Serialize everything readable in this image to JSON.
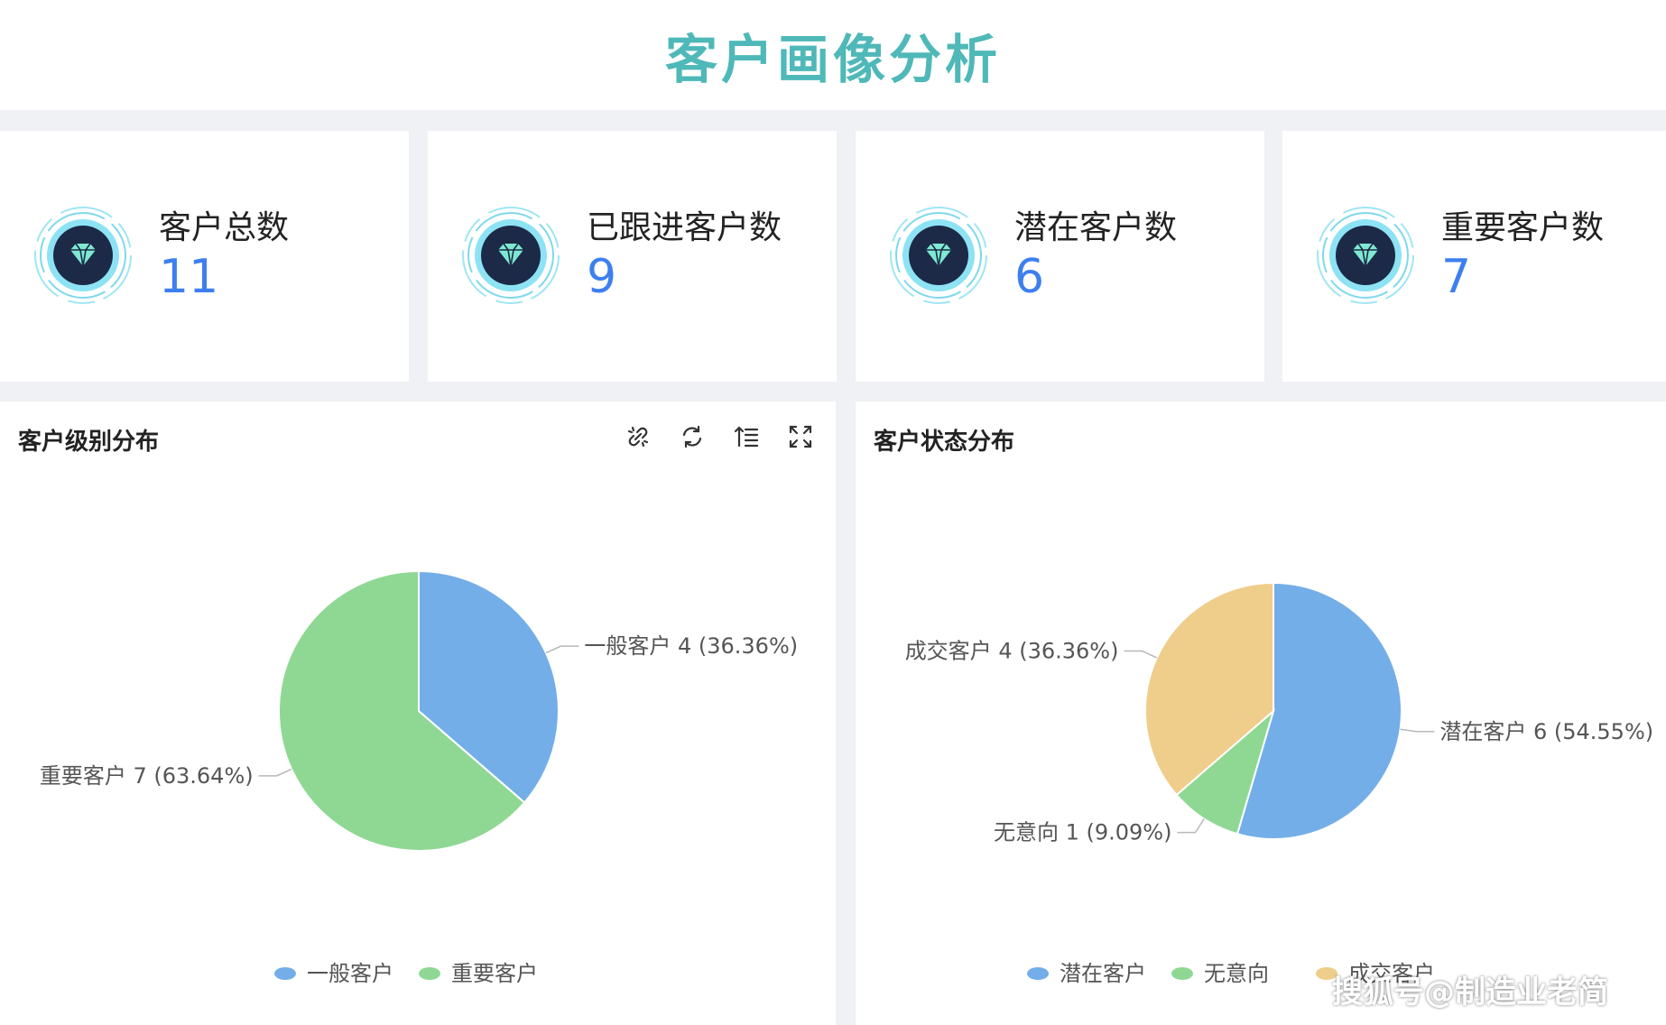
{
  "page": {
    "title": "客户画像分析"
  },
  "stats": [
    {
      "label": "客户总数",
      "value": "11",
      "icon": "diamond-icon"
    },
    {
      "label": "已跟进客户数",
      "value": "9",
      "icon": "diamond-icon"
    },
    {
      "label": "潜在客户数",
      "value": "6",
      "icon": "diamond-icon"
    },
    {
      "label": "重要客户数",
      "value": "7",
      "icon": "diamond-icon"
    }
  ],
  "panels": {
    "level": {
      "title": "客户级别分布",
      "toolbar": [
        "link-icon",
        "refresh-icon",
        "sort-icon",
        "fullscreen-icon"
      ]
    },
    "status": {
      "title": "客户状态分布"
    }
  },
  "colors": {
    "title": "#4fb8b8",
    "value": "#3d7ff0",
    "blue": "#73aee8",
    "green": "#8fd894",
    "yellow": "#efcd8a"
  },
  "watermark": "搜狐号@制造业老简",
  "chart_data": [
    {
      "type": "pie",
      "title": "客户级别分布",
      "slices": [
        {
          "name": "一般客户",
          "value": 4,
          "percent": "36.36%",
          "color": "#73aee8",
          "label": "一般客户  4 (36.36%)"
        },
        {
          "name": "重要客户",
          "value": 7,
          "percent": "63.64%",
          "color": "#8fd894",
          "label": "重要客户  7 (63.64%)"
        }
      ],
      "legend": [
        "一般客户",
        "重要客户"
      ],
      "legend_position": "bottom"
    },
    {
      "type": "pie",
      "title": "客户状态分布",
      "slices": [
        {
          "name": "潜在客户",
          "value": 6,
          "percent": "54.55%",
          "color": "#73aee8",
          "label": "潜在客户  6 (54.55%)"
        },
        {
          "name": "无意向",
          "value": 1,
          "percent": "9.09%",
          "color": "#8fd894",
          "label": "无意向  1 (9.09%)"
        },
        {
          "name": "成交客户",
          "value": 4,
          "percent": "36.36%",
          "color": "#efcd8a",
          "label": "成交客户  4 (36.36%)"
        }
      ],
      "legend": [
        "潜在客户",
        "无意向",
        "成交客户"
      ],
      "legend_position": "bottom"
    }
  ]
}
